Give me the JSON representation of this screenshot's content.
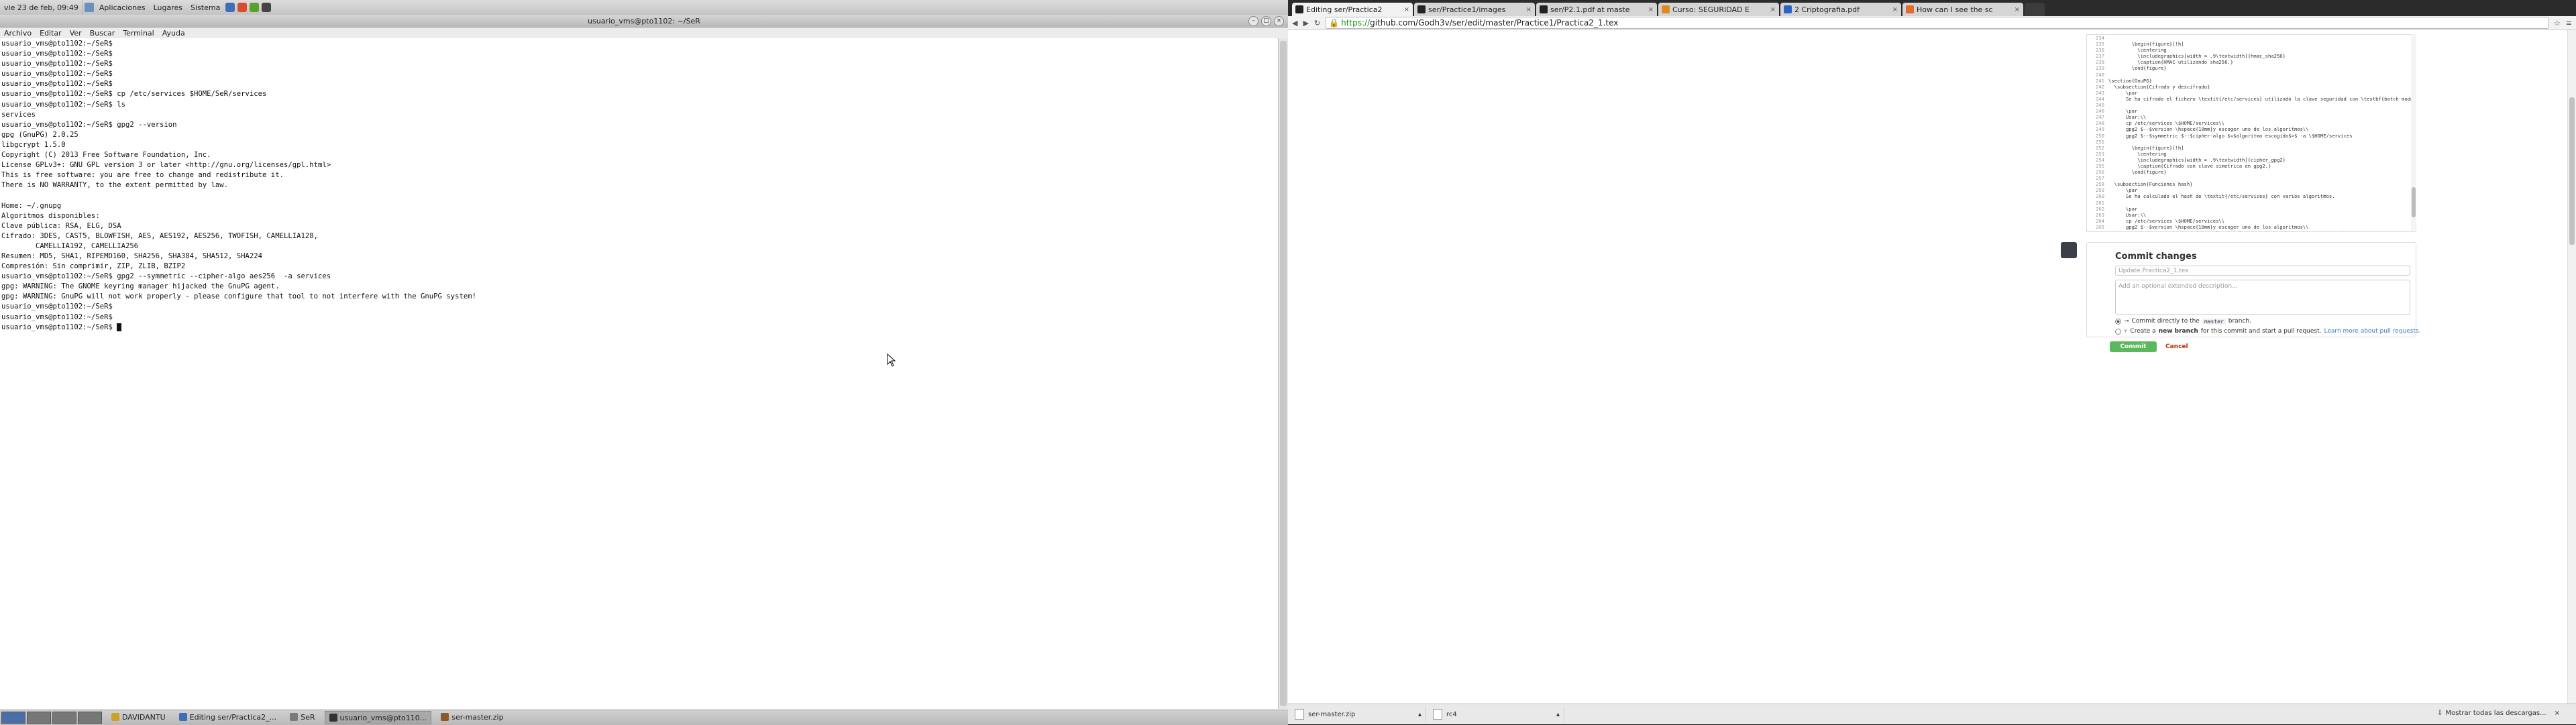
{
  "top_panel": {
    "clock": "vie 23 de feb, 09:49",
    "menus": [
      "Aplicaciones",
      "Lugares",
      "Sistema"
    ]
  },
  "terminal": {
    "title": "usuario_vms@pto1102: ~/SeR",
    "menu": [
      "Archivo",
      "Editar",
      "Ver",
      "Buscar",
      "Terminal",
      "Ayuda"
    ],
    "lines": [
      "usuario_vms@pto1102:~/SeR$",
      "usuario_vms@pto1102:~/SeR$",
      "usuario_vms@pto1102:~/SeR$",
      "usuario_vms@pto1102:~/SeR$",
      "usuario_vms@pto1102:~/SeR$",
      "usuario_vms@pto1102:~/SeR$ cp /etc/services $HOME/SeR/services",
      "usuario_vms@pto1102:~/SeR$ ls",
      "services",
      "usuario_vms@pto1102:~/SeR$ gpg2 --version",
      "gpg (GnuPG) 2.0.25",
      "libgcrypt 1.5.0",
      "Copyright (C) 2013 Free Software Foundation, Inc.",
      "License GPLv3+: GNU GPL version 3 or later <http://gnu.org/licenses/gpl.html>",
      "This is free software: you are free to change and redistribute it.",
      "There is NO WARRANTY, to the extent permitted by law.",
      "",
      "Home: ~/.gnupg",
      "Algoritmos disponibles:",
      "Clave pública: RSA, ELG, DSA",
      "Cifrado: 3DES, CAST5, BLOWFISH, AES, AES192, AES256, TWOFISH, CAMELLIA128,",
      "        CAMELLIA192, CAMELLIA256",
      "Resumen: MD5, SHA1, RIPEMD160, SHA256, SHA384, SHA512, SHA224",
      "Compresión: Sin comprimir, ZIP, ZLIB, BZIP2",
      "usuario_vms@pto1102:~/SeR$ gpg2 --symmetric --cipher-algo aes256  -a services",
      "gpg: WARNING: The GNOME keyring manager hijacked the GnuPG agent.",
      "gpg: WARNING: GnuPG will not work properly - please configure that tool to not interfere with the GnuPG system!",
      "usuario_vms@pto1102:~/SeR$",
      "usuario_vms@pto1102:~/SeR$",
      "usuario_vms@pto1102:~/SeR$"
    ]
  },
  "browser": {
    "tabs": [
      {
        "label": "Editing ser/Practica2",
        "active": true,
        "color": "#222222"
      },
      {
        "label": "ser/Practice1/images",
        "active": false,
        "color": "#222222"
      },
      {
        "label": "ser/P2.1.pdf at maste",
        "active": false,
        "color": "#222222"
      },
      {
        "label": "Curso: SEGURIDAD E",
        "active": false,
        "color": "#e08a1e"
      },
      {
        "label": "2 Criptografia.pdf",
        "active": false,
        "color": "#2a64c5"
      },
      {
        "label": "How can I see the sc",
        "active": false,
        "color": "#e56a2b"
      }
    ],
    "url_scheme": "https://",
    "url_rest": "github.com/Godh3v/ser/edit/master/Practice1/Practica2_1.tex",
    "editor_lines": [
      {
        "n": "234",
        "t": ""
      },
      {
        "n": "235",
        "t": "        \\begin{figure}[!h]"
      },
      {
        "n": "236",
        "t": "          \\centering"
      },
      {
        "n": "237",
        "t": "          \\includegraphics[width = .9\\textwidth]{hmac_sha256}"
      },
      {
        "n": "238",
        "t": "          \\caption{HMAC utilizando sha256.}"
      },
      {
        "n": "239",
        "t": "        \\end{figure}"
      },
      {
        "n": "240",
        "t": ""
      },
      {
        "n": "241",
        "t": "\\section{GnuPG}"
      },
      {
        "n": "242",
        "t": "  \\subsection{Cifrado y descifrado}"
      },
      {
        "n": "243",
        "t": "      \\par"
      },
      {
        "n": "244",
        "t": "      Se ha cifrado el fichero \\textit{/etc/services} utilizado la clave seguridad con \\textbf{batch mode}, modo por bloques."
      },
      {
        "n": "245",
        "t": ""
      },
      {
        "n": "246",
        "t": "      \\par"
      },
      {
        "n": "247",
        "t": "      Usar:\\\\"
      },
      {
        "n": "248",
        "t": "      cp /etc/services \\$HOME/services\\\\"
      },
      {
        "n": "249",
        "t": "      gpg2 $--$version \\hspace{10mm}y escoger uno de los algoritmos\\\\"
      },
      {
        "n": "250",
        "t": "      gpg2 $--$symmetric $--$cipher-algo $<$algoritmo escogido$>$ -a \\$HOME/services"
      },
      {
        "n": "251",
        "t": ""
      },
      {
        "n": "252",
        "t": "        \\begin{figure}[!h]"
      },
      {
        "n": "253",
        "t": "          \\centering"
      },
      {
        "n": "254",
        "t": "          \\includegraphics[width = .9\\textwidth]{cipher_gpg2}"
      },
      {
        "n": "255",
        "t": "          \\caption{Cifrado con clave simetrica en gpg2.}"
      },
      {
        "n": "256",
        "t": "        \\end{figure}"
      },
      {
        "n": "257",
        "t": ""
      },
      {
        "n": "258",
        "t": "  \\subsection{Funciones hash}"
      },
      {
        "n": "259",
        "t": "      \\par"
      },
      {
        "n": "260",
        "t": "      Se ha calculado el hash de \\textit{/etc/services} con varios algoritmos."
      },
      {
        "n": "261",
        "t": ""
      },
      {
        "n": "262",
        "t": "      \\par"
      },
      {
        "n": "263",
        "t": "      Usar:\\\\"
      },
      {
        "n": "264",
        "t": "      cp /etc/services \\$HOME/services\\\\"
      },
      {
        "n": "265",
        "t": "      gpg2 $--$version \\hspace{10mm}y escoger uno de los algoritmos\\\\"
      },
      {
        "n": "266",
        "t": "      gpg2 $--$symmetric $--$cipher-algo $<$algoritmo escogido$>$ -a \\$HOME/services"
      },
      {
        "n": "267",
        "t": ""
      },
      {
        "n": "268",
        "t": "        \\begin{figure}[!h]"
      },
      {
        "n": "269",
        "t": "          \\centering"
      }
    ],
    "commit": {
      "title": "Commit changes",
      "summary_placeholder": "Update Practica2_1.tex",
      "desc_placeholder": "Add an optional extended description...",
      "opt1_prefix": "Commit directly to the",
      "opt1_branch": "master",
      "opt1_suffix": "branch.",
      "opt2_prefix": "Create a",
      "opt2_bold": "new branch",
      "opt2_mid": "for this commit and start a pull request.",
      "opt2_link": "Learn more about pull requests.",
      "commit_button": "Commit changes",
      "cancel": "Cancel"
    },
    "downloads": [
      {
        "name": "ser-master.zip"
      },
      {
        "name": "rc4"
      }
    ],
    "show_all_downloads": "Mostrar todas las descargas..."
  },
  "taskbar": {
    "tasks": [
      {
        "label": "DAVIDANTU",
        "active": false
      },
      {
        "label": "Editing ser/Practica2_...",
        "active": false
      },
      {
        "label": "SeR",
        "active": false
      },
      {
        "label": "usuario_vms@pto110...",
        "active": true
      },
      {
        "label": "ser-master.zip",
        "active": false
      }
    ]
  },
  "colors": {
    "commit_green": "#5cb85c",
    "link_blue": "#4078c0",
    "cancel_red": "#bd2c00"
  }
}
